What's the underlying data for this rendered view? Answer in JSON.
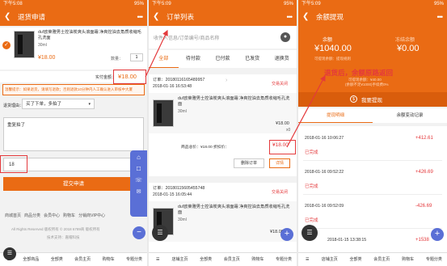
{
  "status_bar": {
    "s1_left": "下午5:08",
    "s1_right": "95%",
    "s2_left": "下午5:09",
    "s2_right": "95%",
    "s3_left": "下午5:09",
    "s3_right": "95%"
  },
  "screen1": {
    "nav_title": "退货申请",
    "product_name": "du!欧莱雅男士控油炭爽头滚面霜 净爽控油去角质收缩毛孔洗面",
    "product_size": "30ml",
    "product_price": "¥18.00",
    "qty_label": "数量：",
    "qty_value": "1",
    "refund_label": "实付金额：",
    "refund_value": "¥18.00",
    "warm_tip": "温馨提示：如果退货，请填写退款；否则退款10分钟内人工确认进入审核中大厦",
    "reason_label": "退货理由：",
    "reason_value": "买了下单，多拍了",
    "textarea_value": "重复拍了",
    "amount_value": "18",
    "submit_label": "提交申请",
    "footer_links": [
      "商城首页",
      "商品分类",
      "会员中心",
      "购物车",
      "分销商VIP中心"
    ],
    "copyright": "All Rights Reserved 版权所有 © 2018 6789商 版权所有",
    "support": "技术支持：嘉帽科技",
    "tabbar": [
      "全部商品",
      "全部类",
      "会员主页",
      "购物车",
      "专题分类"
    ]
  },
  "screen2": {
    "nav_title": "订单列表",
    "search_placeholder": "收件人信息/订单编号/商品名称",
    "tabs": [
      "全部",
      "待付款",
      "已付款",
      "已发货",
      "退换货"
    ],
    "order1": {
      "number": "订单：20180116165489957",
      "date": "2018-01-16 16:53:48",
      "status": "交易关闭",
      "product_name": "du!欧莱雅男士控油炭爽头滚面霜 净爽控油去角质收缩毛孔洗面",
      "size": "30ml",
      "price": "¥18.00",
      "qty": "x0",
      "total_line": "商品总价：¥18.00 折扣价：",
      "total": "¥18.00",
      "btn_delete": "删除订单",
      "btn_detail": "详情"
    },
    "order2": {
      "number": "订单：20180115605455748",
      "date": "2018-01-15 16:05:44",
      "status": "交易关闭",
      "product_name": "du!欧莱雅男士控油炭爽头滚面霜 净爽控油去角质收缩毛孔洗面",
      "size": "30ml",
      "price": "¥18.00"
    },
    "tabbar": [
      "店铺主页",
      "全部类",
      "会员主页",
      "购物车",
      "专题分类"
    ]
  },
  "screen3": {
    "nav_title": "余额提现",
    "balance_label": "余额",
    "balance_value": "¥1040.00",
    "withdraw_label": "冻结余额",
    "withdraw_value": "¥0.00",
    "sub_left": "可提现余额：提现规则",
    "annotation": "退货后，余额原路返回",
    "annotation_sub": "可提现余额：¥40.00",
    "annotation_sub2": "(余额不足¥1000)手续费0%",
    "withdraw_button": "我要提现",
    "tabs": [
      "提现明细",
      "余额变动记录"
    ],
    "records": [
      {
        "date": "2018-01-16 10:06:27",
        "status": "已完成",
        "amount": "+412.61"
      },
      {
        "date": "2018-01-16 09:52:22",
        "status": "已完成",
        "amount": "+426.69"
      },
      {
        "date": "2018-01-16 09:52:09",
        "status": "已完成",
        "amount": "-426.69"
      },
      {
        "date": "2018-01-15 13:38:15",
        "status": "",
        "amount": "+1538"
      }
    ],
    "tabbar": [
      "店铺主页",
      "全部类",
      "会员主页",
      "购物车",
      "专题分类"
    ]
  },
  "colors": {
    "brand": "#ea6b14",
    "highlight": "#e4393c",
    "fab_blue": "#5a6fd6"
  }
}
